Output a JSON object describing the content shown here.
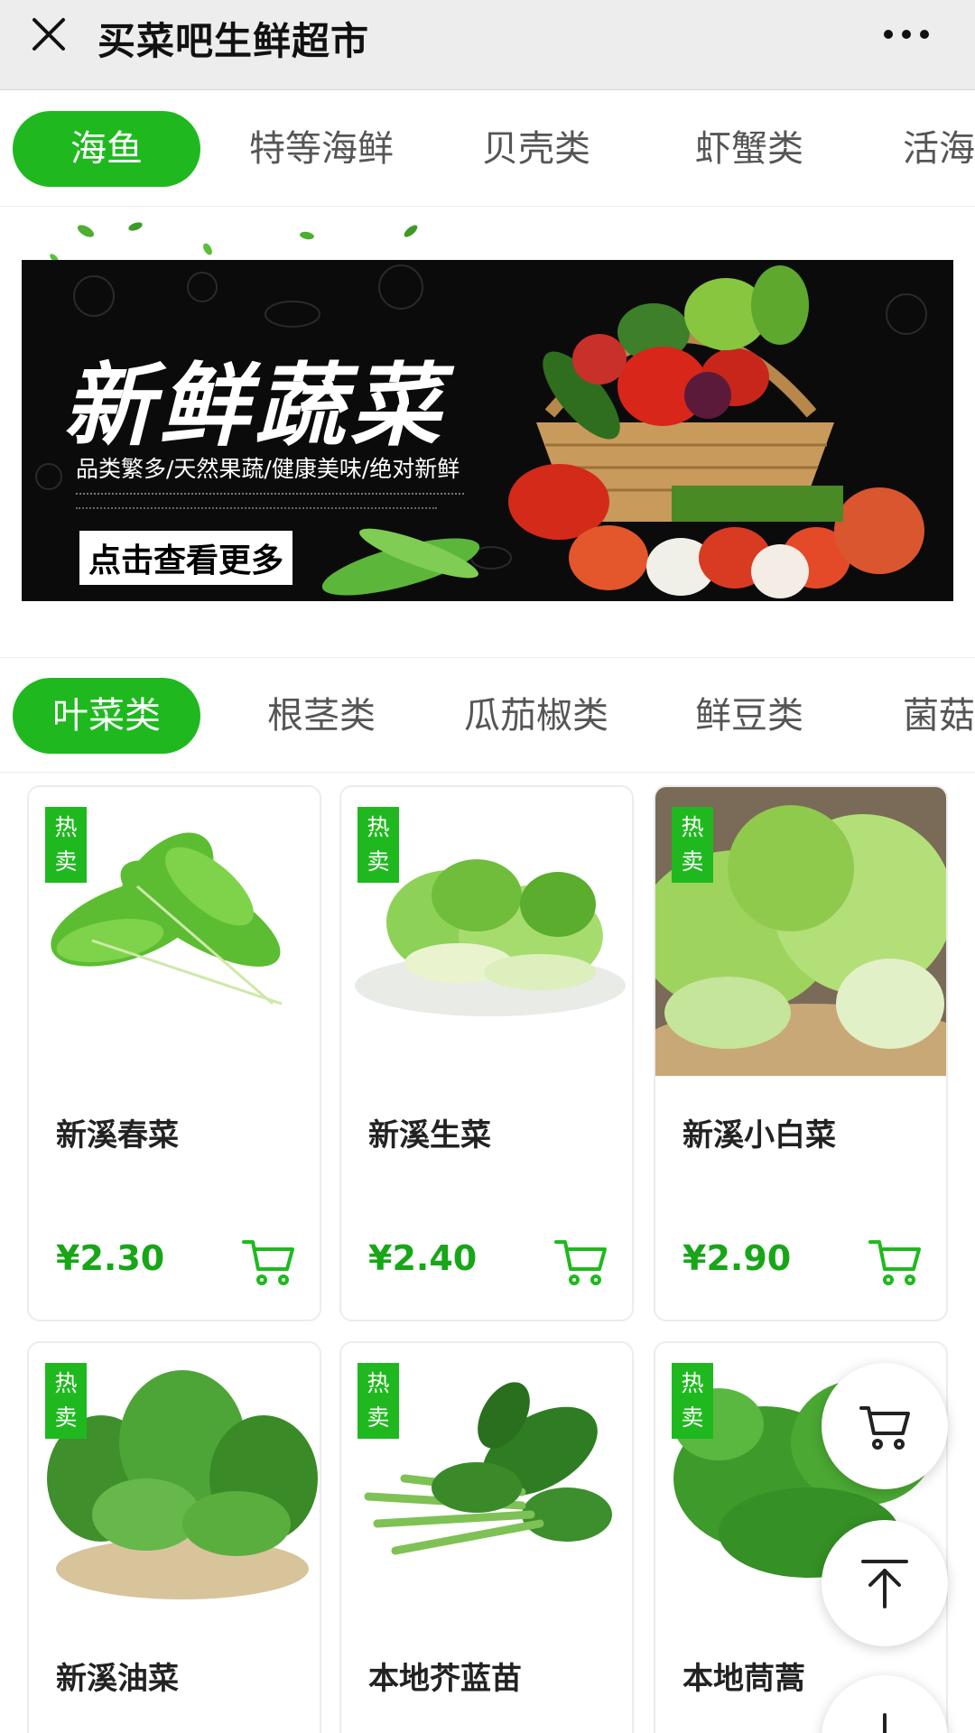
{
  "header": {
    "title": "买菜吧生鲜超市"
  },
  "top_tabs": [
    {
      "label": "海鱼",
      "active": true
    },
    {
      "label": "特等海鲜",
      "active": false
    },
    {
      "label": "贝壳类",
      "active": false
    },
    {
      "label": "虾蟹类",
      "active": false
    },
    {
      "label": "活海",
      "active": false
    }
  ],
  "banner": {
    "title": "新鲜蔬菜",
    "subtitle": "品类繁多/天然果蔬/健康美味/绝对新鲜",
    "cta": "点击查看更多"
  },
  "veg_tabs": [
    {
      "label": "叶菜类",
      "active": true
    },
    {
      "label": "根茎类",
      "active": false
    },
    {
      "label": "瓜茄椒类",
      "active": false
    },
    {
      "label": "鲜豆类",
      "active": false
    },
    {
      "label": "菌菇",
      "active": false
    }
  ],
  "products": [
    {
      "name": "新溪春菜",
      "price": "¥2.30",
      "badge": "热卖"
    },
    {
      "name": "新溪生菜",
      "price": "¥2.40",
      "badge": "热卖"
    },
    {
      "name": "新溪小白菜",
      "price": "¥2.90",
      "badge": "热卖"
    },
    {
      "name": "新溪油菜",
      "price": "",
      "badge": "热卖"
    },
    {
      "name": "本地芥蓝苗",
      "price": "",
      "badge": "热卖"
    },
    {
      "name": "本地茼蒿",
      "price": "",
      "badge": "热卖"
    }
  ],
  "colors": {
    "accent": "#1fb91f",
    "price": "#18a618",
    "titlebar": "#ededed"
  },
  "icons": {
    "close": "close-icon",
    "more": "more-dots-icon",
    "cart": "cart-icon",
    "back_to_top": "arrow-up-icon"
  }
}
